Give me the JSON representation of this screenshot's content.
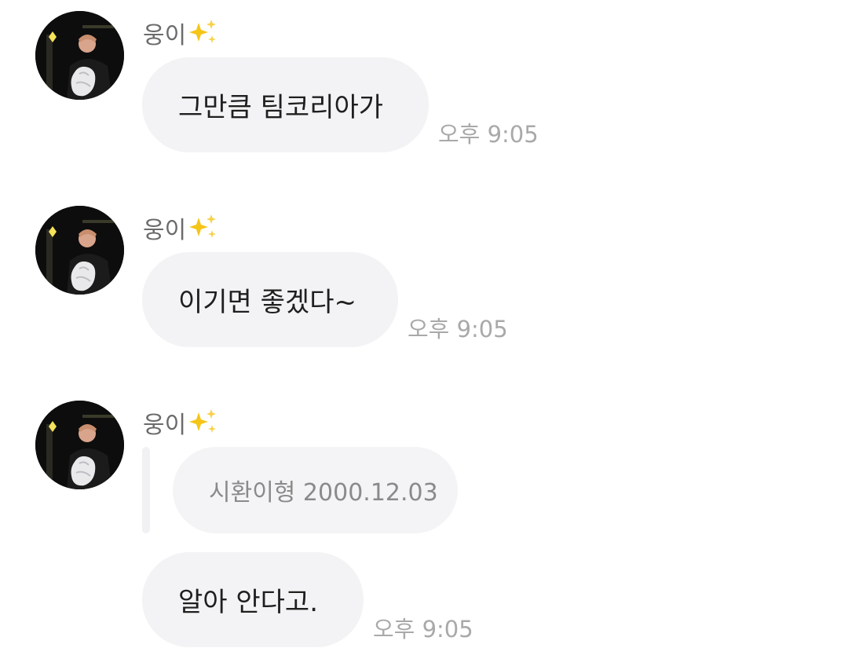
{
  "messages": [
    {
      "sender": "웅이",
      "sender_emoji": "sparkles-icon",
      "text": "그만큼 팀코리아가",
      "time": "오후 9:05"
    },
    {
      "sender": "웅이",
      "sender_emoji": "sparkles-icon",
      "text": "이기면 좋겠다~",
      "time": "오후 9:05"
    },
    {
      "sender": "웅이",
      "sender_emoji": "sparkles-icon",
      "reply_to": "시환이형 2000.12.03",
      "text": "알아 안다고.",
      "time": "오후 9:05"
    }
  ],
  "colors": {
    "bubble": "#f3f3f5",
    "sender_text": "#6b6b6b",
    "time_text": "#a9a9a9",
    "message_text": "#1f1f1f",
    "sparkle": "#f5c518"
  }
}
